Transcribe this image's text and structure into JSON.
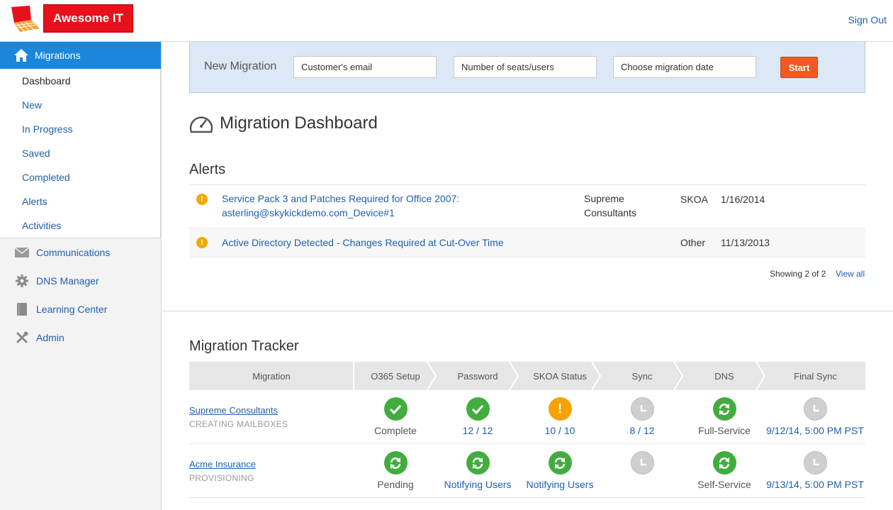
{
  "header": {
    "brand": "Awesome IT",
    "sign_out": "Sign Out"
  },
  "sidebar": {
    "migrations_label": "Migrations",
    "sub_items": [
      {
        "label": "Dashboard",
        "active": true
      },
      {
        "label": "New"
      },
      {
        "label": "In Progress"
      },
      {
        "label": "Saved"
      },
      {
        "label": "Completed"
      },
      {
        "label": "Alerts"
      },
      {
        "label": "Activities"
      }
    ],
    "items": [
      {
        "label": "Communications",
        "icon": "envelope-icon"
      },
      {
        "label": "DNS Manager",
        "icon": "gear-icon"
      },
      {
        "label": "Learning Center",
        "icon": "book-icon"
      },
      {
        "label": "Admin",
        "icon": "tools-icon"
      }
    ]
  },
  "new_migration": {
    "title": "New Migration",
    "email_placeholder": "Customer's email",
    "seats_placeholder": "Number of seats/users",
    "date_placeholder": "Choose migration date",
    "start_label": "Start"
  },
  "dashboard": {
    "title": "Migration Dashboard"
  },
  "alerts": {
    "title": "Alerts",
    "rows": [
      {
        "message_line1": "Service Pack 3 and Patches Required for Office 2007:",
        "message_line2": "asterling@skykickdemo.com_Device#1",
        "customer_line1": "Supreme",
        "customer_line2": "Consultants",
        "type": "SKOA",
        "date": "1/16/2014"
      },
      {
        "message_line1": "Active Directory Detected - Changes Required at Cut-Over Time",
        "customer_line1": "",
        "type": "Other",
        "date": "11/13/2013"
      }
    ],
    "showing": "Showing 2 of 2",
    "view_all": "View all"
  },
  "tracker": {
    "title": "Migration Tracker",
    "columns": [
      "Migration",
      "O365 Setup",
      "Password",
      "SKOA Status",
      "Sync",
      "DNS",
      "Final Sync"
    ],
    "rows": [
      {
        "name": "Supreme Consultants",
        "state": "CREATING MAILBOXES",
        "cells": [
          {
            "status": "check",
            "color": "#42ad3f",
            "label": "Complete"
          },
          {
            "status": "check",
            "color": "#42ad3f",
            "label": "12 / 12"
          },
          {
            "status": "warning",
            "color": "#f4a300",
            "label": "10 / 10"
          },
          {
            "status": "clock",
            "color": "#cfcfcf",
            "label": "8 / 12"
          },
          {
            "status": "sync",
            "color": "#42ad3f",
            "label": "Full-Service"
          },
          {
            "status": "clock",
            "color": "#cfcfcf",
            "label": "9/12/14, 5:00 PM PST"
          }
        ]
      },
      {
        "name": "Acme Insurance",
        "state": "PROVISIONING",
        "cells": [
          {
            "status": "sync",
            "color": "#42ad3f",
            "label": "Pending"
          },
          {
            "status": "sync",
            "color": "#42ad3f",
            "label": "Notifying Users"
          },
          {
            "status": "sync",
            "color": "#42ad3f",
            "label": "Notifying Users"
          },
          {
            "status": "clock",
            "color": "#cfcfcf",
            "label": ""
          },
          {
            "status": "sync",
            "color": "#42ad3f",
            "label": "Self-Service"
          },
          {
            "status": "clock",
            "color": "#cfcfcf",
            "label": "9/13/14, 5:00 PM PST"
          }
        ]
      }
    ]
  }
}
